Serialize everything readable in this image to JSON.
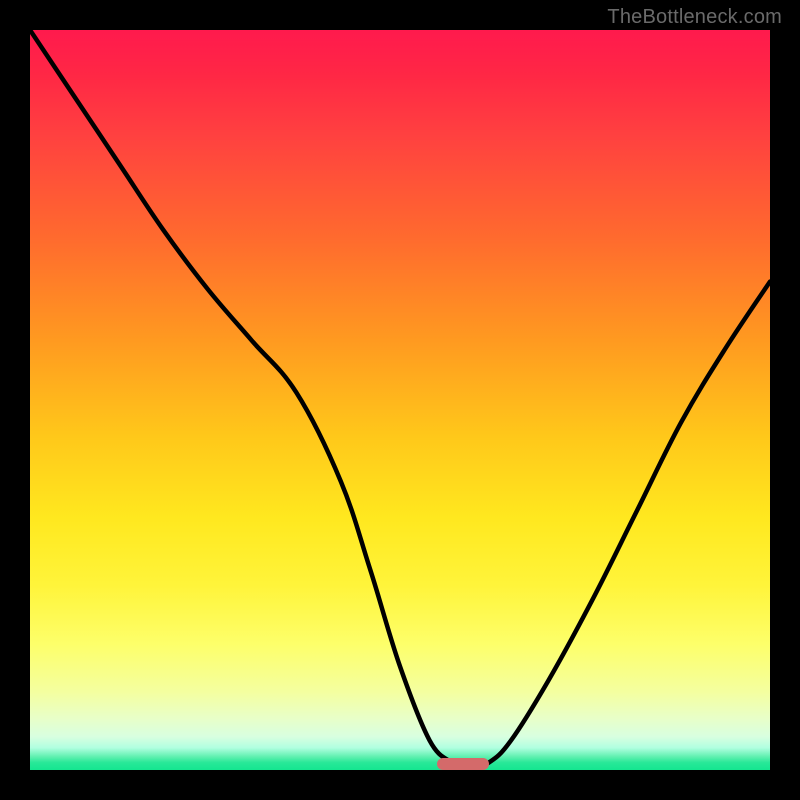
{
  "watermark": "TheBottleneck.com",
  "colors": {
    "frame_bg": "#000000",
    "curve": "#000000",
    "marker": "#d46a6a",
    "gradient_top": "#ff1a4d",
    "gradient_bottom": "#14e690"
  },
  "chart_data": {
    "type": "line",
    "title": "",
    "xlabel": "",
    "ylabel": "",
    "xlim": [
      0,
      100
    ],
    "ylim": [
      0,
      100
    ],
    "grid": false,
    "legend": false,
    "series": [
      {
        "name": "bottleneck-curve",
        "x": [
          0,
          6,
          12,
          18,
          24,
          30,
          36,
          42,
          46,
          50,
          54,
          57,
          59,
          62,
          65,
          70,
          76,
          82,
          88,
          94,
          100
        ],
        "values": [
          100,
          91,
          82,
          73,
          65,
          58,
          51,
          39,
          27,
          14,
          4,
          1,
          0,
          1,
          4,
          12,
          23,
          35,
          47,
          57,
          66
        ]
      }
    ],
    "annotations": [
      {
        "name": "optimal-range-marker",
        "x_start": 55,
        "x_end": 62,
        "y": 0
      }
    ]
  }
}
